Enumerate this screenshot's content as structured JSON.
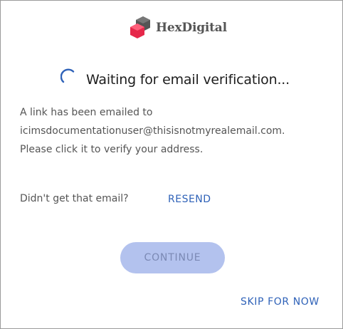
{
  "brand": {
    "name": "HexDigital",
    "logo_icon": "hexagon-cube-logo",
    "logo_colors": [
      "#e6284a",
      "#555555"
    ]
  },
  "status": {
    "spinner_icon": "loading-spinner-icon",
    "heading": "Waiting for email verification..."
  },
  "message": {
    "line1": "A link has been emailed to",
    "line2": "icimsdocumentationuser@thisisnotmyrealemail.com.",
    "line3": "Please click it to verify your address."
  },
  "resend": {
    "prompt": "Didn't get that email?",
    "link_label": "RESEND"
  },
  "actions": {
    "continue_label": "CONTINUE",
    "continue_disabled": true,
    "skip_label": "SKIP FOR NOW"
  },
  "colors": {
    "accent": "#2f62b8",
    "button_disabled_bg": "#b3c2ee",
    "text_muted": "#555555"
  }
}
